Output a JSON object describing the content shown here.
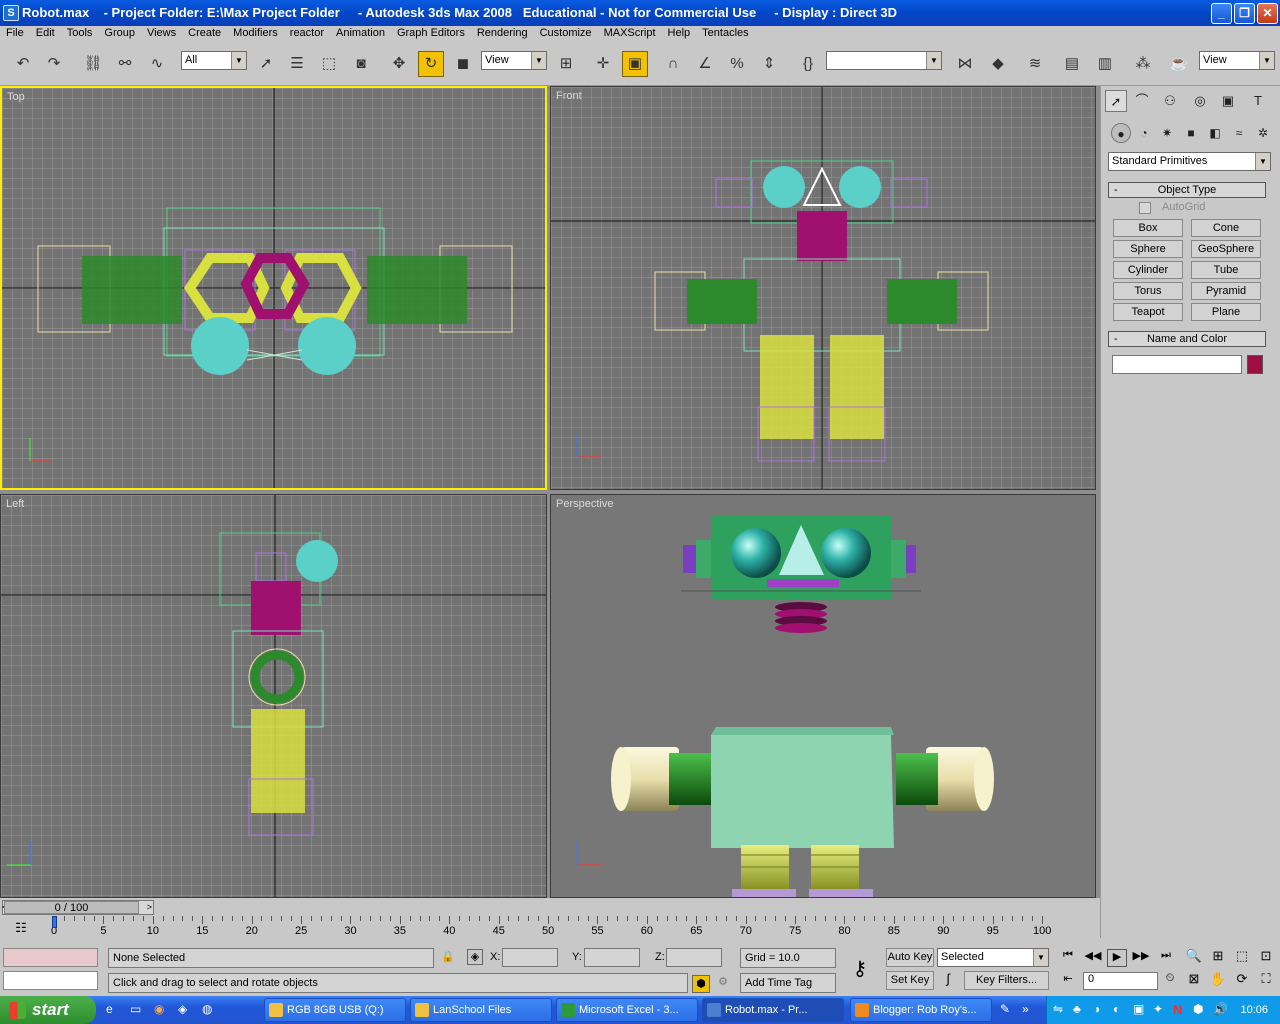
{
  "window": {
    "title": "Robot.max    - Project Folder: E:\\Max Project Folder     - Autodesk 3ds Max 2008   Educational - Not for Commercial Use     - Display : Direct 3D",
    "app_icon": "3ds-max-icon",
    "minimize": "_",
    "maximize": "❐",
    "close": "✕"
  },
  "menu": [
    "File",
    "Edit",
    "Tools",
    "Group",
    "Views",
    "Create",
    "Modifiers",
    "reactor",
    "Animation",
    "Graph Editors",
    "Rendering",
    "Customize",
    "MAXScript",
    "Help",
    "Tentacles"
  ],
  "toolbar": {
    "selection_filter": "All",
    "ref_coord_1": "View",
    "named_selection": "",
    "ref_coord_2": "View"
  },
  "viewports": {
    "top": "Top",
    "front": "Front",
    "left": "Left",
    "perspective": "Perspective"
  },
  "command_panel": {
    "category_dropdown": "Standard Primitives",
    "object_type": {
      "header": "Object Type",
      "autogrid": "AutoGrid",
      "buttons": [
        "Box",
        "Cone",
        "Sphere",
        "GeoSphere",
        "Cylinder",
        "Tube",
        "Torus",
        "Pyramid",
        "Teapot",
        "Plane"
      ]
    },
    "name_color": {
      "header": "Name and Color",
      "name_value": "",
      "color": "#9b1040"
    }
  },
  "timeline": {
    "slider_label": "0 / 100",
    "ticks": [
      "0",
      "5",
      "10",
      "15",
      "20",
      "25",
      "30",
      "35",
      "40",
      "45",
      "50",
      "55",
      "60",
      "65",
      "70",
      "75",
      "80",
      "85",
      "90",
      "95",
      "100"
    ]
  },
  "status": {
    "selection": "None Selected",
    "prompt": "Click and drag to select and rotate objects",
    "x_label": "X:",
    "y_label": "Y:",
    "z_label": "Z:",
    "grid": "Grid = 10.0",
    "add_time_tag": "Add Time Tag",
    "auto_key": "Auto Key",
    "set_key": "Set Key",
    "key_mode": "Selected",
    "key_filters": "Key Filters...",
    "frame": "0"
  },
  "taskbar": {
    "start": "start",
    "tasks": [
      "RGB 8GB USB (Q:)",
      "LanSchool Files",
      "Microsoft Excel - 3...",
      "Robot.max       - Pr...",
      "Blogger: Rob Roy's..."
    ],
    "clock": "10:06"
  }
}
